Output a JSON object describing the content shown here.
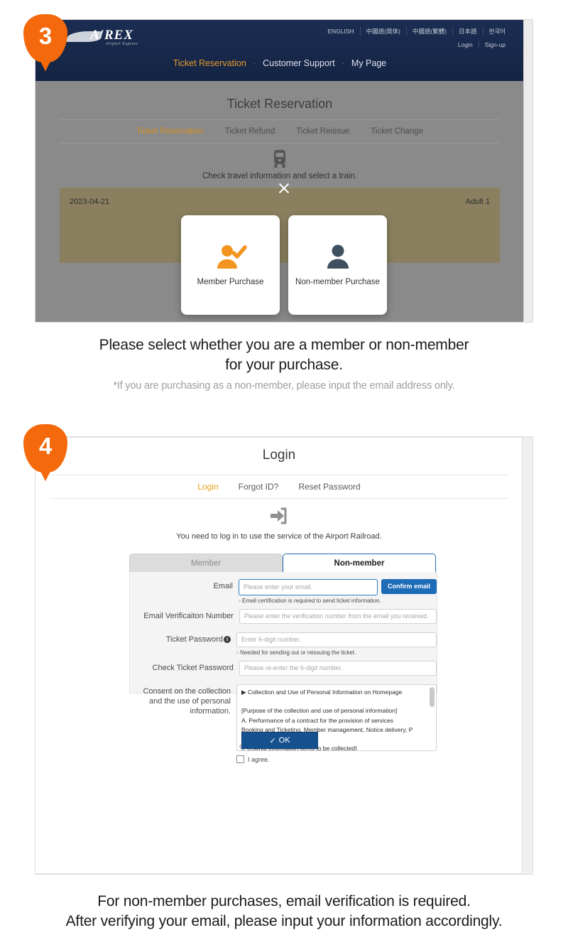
{
  "steps": [
    {
      "number": "3"
    },
    {
      "number": "4"
    }
  ],
  "section3": {
    "site": {
      "logo_word": "A'REX",
      "logo_sub": "Airport Express",
      "languages": [
        "ENGLISH",
        "中國語(简体)",
        "中國語(繁體)",
        "日本語",
        "한국어"
      ],
      "account": [
        "Login",
        "Sign-up"
      ],
      "gnb": [
        {
          "label": "Ticket Reservation",
          "active": true
        },
        {
          "label": "Customer Support",
          "active": false
        },
        {
          "label": "My Page",
          "active": false
        }
      ],
      "gnb_separator": "·"
    },
    "page_title": "Ticket Reservation",
    "subtabs": [
      {
        "label": "Ticket Reservation",
        "active": true
      },
      {
        "label": "Ticket Refund",
        "active": false
      },
      {
        "label": "Ticket Reissue",
        "active": false
      },
      {
        "label": "Ticket Change",
        "active": false
      }
    ],
    "lead_text": "Check travel information and select a train.",
    "search": {
      "date": "2023-04-21",
      "passengers": "Adult 1"
    },
    "modal": {
      "close_label": "×",
      "options": [
        {
          "label": "Member Purchase",
          "icon": "member-user-check-icon",
          "color": "#f2941f"
        },
        {
          "label": "Non-member Purchase",
          "icon": "nonmember-user-icon",
          "color": "#3f5061"
        }
      ]
    }
  },
  "caption3": {
    "line1": "Please select whether you are a member or non-member",
    "line2": "for your purchase.",
    "note": "*If you are purchasing as a non-member, please input the email address only."
  },
  "section4": {
    "page_title": "Login",
    "tabs": [
      {
        "label": "Login",
        "active": true
      },
      {
        "label": "Forgot ID?",
        "active": false
      },
      {
        "label": "Reset Password",
        "active": false
      }
    ],
    "description": "You need to log in to use the service of the Airport Railroad.",
    "member_tabs": [
      {
        "label": "Member",
        "active": false
      },
      {
        "label": "Non-member",
        "active": true
      }
    ],
    "form": {
      "email": {
        "label": "Email",
        "placeholder": "Please enter your email.",
        "value": "",
        "button": "Confirm email",
        "note": "Email certification is required to send ticket information."
      },
      "verification": {
        "label": "Email Verificaiton Number",
        "placeholder": "Please enter the verification number from the email you received.",
        "value": ""
      },
      "ticket_password": {
        "label": "Ticket Password",
        "placeholder": "Enter 6-digit number.",
        "value": "",
        "note": "Needed for sending out or reissuing the ticket."
      },
      "check_ticket_password": {
        "label": "Check Ticket Password",
        "placeholder": "Please re-enter the 6-digit number.",
        "value": ""
      },
      "consent": {
        "label": "Consent on the collection and the use of personal information.",
        "lines": [
          "▶ Collection and Use of Personal Information on Homepage",
          "",
          "[Purpose of the collection and use of personal information]",
          "A. Performance of a contract for the provision of services",
          "Booking and Ticketing, Member management, Notice delivery, P",
          "",
          "[Personal information items to be collected]"
        ],
        "agree_label": "I agree.",
        "agree_checked": false
      }
    },
    "ok_button": "OK"
  },
  "caption4": {
    "line1": "For non-member purchases, email verification is required.",
    "line2": "After verifying your email, please input your information accordingly."
  },
  "colors": {
    "accent_orange": "#f4690b",
    "brand_navy": "#16284a",
    "link_gold": "#e3a11d",
    "primary_blue": "#1e6bb8",
    "ok_blue": "#17508f"
  }
}
